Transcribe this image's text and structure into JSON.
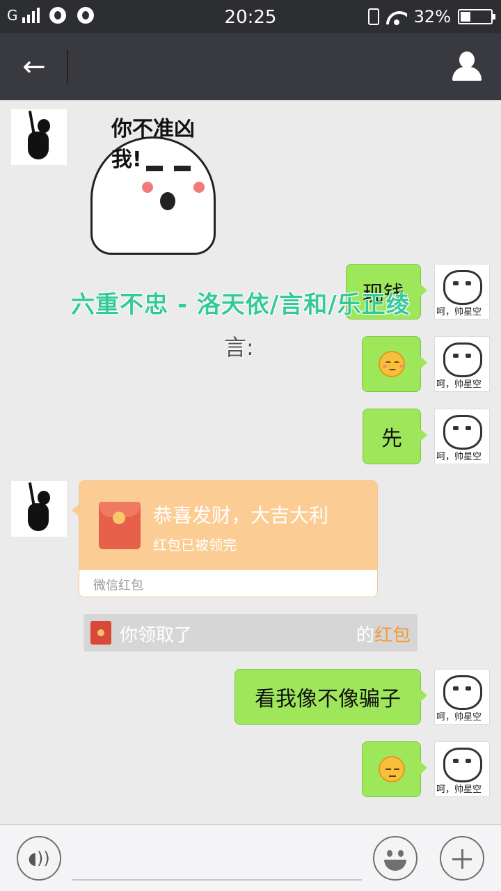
{
  "status_bar": {
    "carrier": "G",
    "time": "20:25",
    "battery": "32%",
    "battery_level": 0.32
  },
  "nav": {
    "back_icon": "arrow-left-icon",
    "profile_icon": "user-profile-icon"
  },
  "messages": [
    {
      "from": "friend",
      "type": "sticker",
      "text": "你不准凶我!"
    },
    {
      "from": "self",
      "type": "text",
      "text": "现钱"
    },
    {
      "from": "self",
      "type": "emoji",
      "emoji": "blush-smile"
    },
    {
      "from": "self",
      "type": "text",
      "text": "先"
    },
    {
      "from": "friend",
      "type": "red_packet",
      "title": "恭喜发财，大吉大利",
      "status": "红包已被领完",
      "brand": "微信红包"
    },
    {
      "from": "system",
      "type": "notice",
      "text": "你领取了",
      "suffix": "的",
      "highlight": "红包"
    },
    {
      "from": "self",
      "type": "text",
      "text": "看我像不像骗子"
    },
    {
      "from": "self",
      "type": "emoji",
      "emoji": "unamused"
    }
  ],
  "self_avatar_caption": "呵，帅星空",
  "overlay": {
    "line1": "六重不忠 - 洛天依/言和/乐正绫",
    "line2": "言:"
  },
  "colors": {
    "nav_bg": "#393a3f",
    "chat_bg": "#ebebeb",
    "bubble_green": "#9fe75a",
    "red_packet": "#fbcd95",
    "overlay_text": "#35c99a"
  }
}
